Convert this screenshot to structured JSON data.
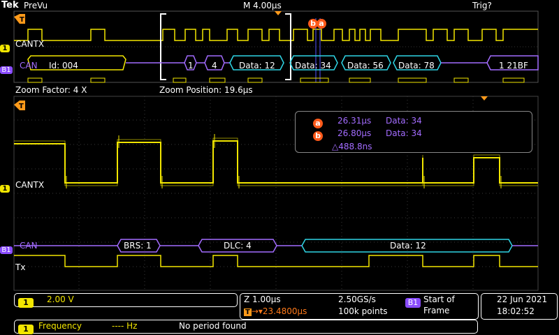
{
  "top": {
    "brand": "Tek",
    "mode": "PreVu",
    "timebase": "M 4.00µs",
    "trigger_status": "Trig?"
  },
  "overview": {
    "ch1_label": "CANTX",
    "bus_label": "CAN",
    "bus_id": "B1",
    "packets": [
      "Id: 004",
      "1",
      "4",
      "Data: 12",
      "Data: 34",
      "Data: 56",
      "Data: 78",
      "1 21BF"
    ]
  },
  "zoom": {
    "factor_label": "Zoom Factor: 4 X",
    "position_label": "Zoom Position: 19.6µs"
  },
  "cursors": {
    "a_label": "a",
    "a_time": "26.31µs",
    "a_data": "Data: 34",
    "b_label": "b",
    "b_time": "26.80µs",
    "b_data": "Data: 34",
    "delta": "△488.8ns"
  },
  "main": {
    "ch1_label": "CANTX",
    "bus_label": "CAN",
    "packets": [
      "BRS: 1",
      "DLC: 4",
      "Data: 12"
    ],
    "tx_label": "Tx"
  },
  "status": {
    "ch1_num": "1",
    "ch1_scale": "2.00 V",
    "zoom_scale": "Z 1.00µs",
    "sample_rate": "2.50GS/s",
    "trigger_pos": "23.4800µs",
    "record_length": "100k points",
    "trig_source": "B1",
    "trig_event": "Start of Frame",
    "date": "22 Jun  2021",
    "time": "18:02:52"
  },
  "meas": {
    "ch": "1",
    "name": "Frequency",
    "value": "---- Hz",
    "msg": "No period found"
  },
  "colors": {
    "ch1": "#f2e600",
    "bus": "#a36cff",
    "data": "#2fd6e6",
    "cursor": "#ff5a1a"
  }
}
